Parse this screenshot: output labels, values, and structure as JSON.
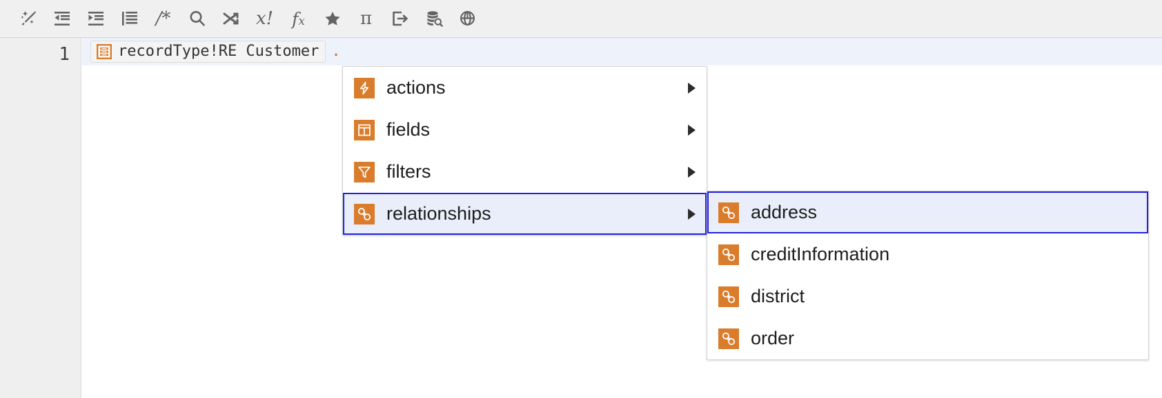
{
  "toolbar": {
    "buttons": [
      {
        "icon": "magic-wand-icon",
        "label": "Format expression"
      },
      {
        "icon": "outdent-icon",
        "label": "Outdent"
      },
      {
        "icon": "indent-icon",
        "label": "Indent"
      },
      {
        "icon": "list-lines-icon",
        "label": "Toggle line wrap"
      },
      {
        "icon": "comment-icon",
        "label": "/*"
      },
      {
        "icon": "search-icon",
        "label": "Find"
      },
      {
        "icon": "shuffle-icon",
        "label": "Shuffle"
      },
      {
        "icon": "variable-bang-icon",
        "label": "x!"
      },
      {
        "icon": "function-icon",
        "label": "fx"
      },
      {
        "icon": "star-icon",
        "label": "Favorites"
      },
      {
        "icon": "pi-icon",
        "label": "Constants"
      },
      {
        "icon": "export-icon",
        "label": "Export"
      },
      {
        "icon": "database-search-icon",
        "label": "Query database"
      },
      {
        "icon": "globe-icon",
        "label": "Web service"
      }
    ]
  },
  "editor": {
    "line_number": "1",
    "record_type_chip": {
      "icon": "record-type-icon",
      "text": "recordType!RE Customer"
    },
    "dot": "."
  },
  "menu_primary": {
    "items": [
      {
        "icon": "lightning-bolt-icon",
        "label": "actions",
        "has_submenu": true,
        "selected": false
      },
      {
        "icon": "table-columns-icon",
        "label": "fields",
        "has_submenu": true,
        "selected": false
      },
      {
        "icon": "funnel-icon",
        "label": "filters",
        "has_submenu": true,
        "selected": false
      },
      {
        "icon": "chain-link-icon",
        "label": "relationships",
        "has_submenu": true,
        "selected": true
      }
    ]
  },
  "menu_secondary": {
    "items": [
      {
        "icon": "chain-link-icon",
        "label": "address",
        "has_submenu": false,
        "selected": true
      },
      {
        "icon": "chain-link-icon",
        "label": "creditInformation",
        "has_submenu": false,
        "selected": false
      },
      {
        "icon": "chain-link-icon",
        "label": "district",
        "has_submenu": false,
        "selected": false
      },
      {
        "icon": "chain-link-icon",
        "label": "order",
        "has_submenu": false,
        "selected": false
      }
    ]
  },
  "colors": {
    "accent_orange": "#d97c2b",
    "selection_border": "#2222dd",
    "selection_fill": "#eaeefa",
    "toolbar_bg": "#f0f0f0",
    "gutter_bg": "#efefef",
    "code_dot": "#d2691e"
  }
}
